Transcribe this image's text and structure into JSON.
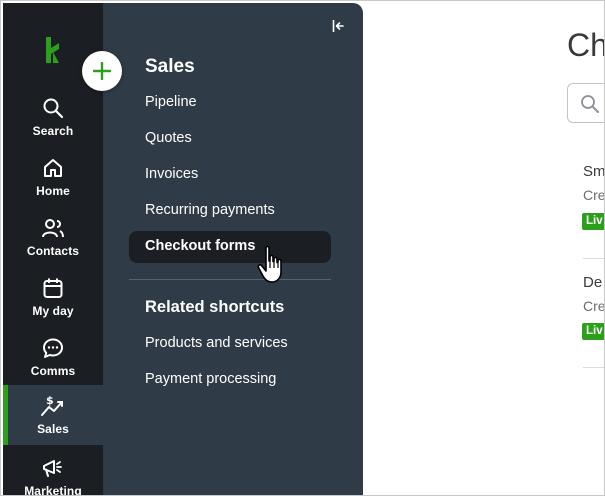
{
  "rail": {
    "items": [
      {
        "label": "Search",
        "icon": "search-icon"
      },
      {
        "label": "Home",
        "icon": "home-icon"
      },
      {
        "label": "Contacts",
        "icon": "contacts-icon"
      },
      {
        "label": "My day",
        "icon": "calendar-icon"
      },
      {
        "label": "Comms",
        "icon": "chat-icon"
      },
      {
        "label": "Sales",
        "icon": "sales-icon",
        "active": true
      },
      {
        "label": "Marketing",
        "icon": "megaphone-icon"
      }
    ]
  },
  "panel": {
    "title": "Sales",
    "links": [
      "Pipeline",
      "Quotes",
      "Invoices",
      "Recurring payments",
      "Checkout forms"
    ],
    "selected_link": "Checkout forms",
    "related_title": "Related shortcuts",
    "related_links": [
      "Products and services",
      "Payment processing"
    ]
  },
  "main": {
    "title": "Ch",
    "cards": [
      {
        "title": "Sm",
        "subtitle": "Cre",
        "badge": "Liv"
      },
      {
        "title": "De",
        "subtitle": "Cre",
        "badge": "Liv"
      }
    ]
  },
  "colors": {
    "rail_bg": "#1b1f23",
    "panel_bg": "#2f3b46",
    "accent_green": "#2ca01c",
    "selected_bg": "#1b1f23"
  }
}
